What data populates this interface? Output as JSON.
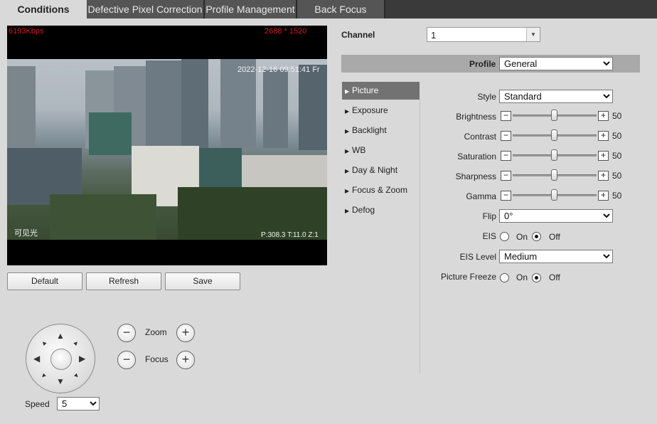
{
  "tabs": [
    {
      "label": "Conditions"
    },
    {
      "label": "Defective Pixel Correction"
    },
    {
      "label": "Profile Management"
    },
    {
      "label": "Back Focus"
    }
  ],
  "video": {
    "bitrate": "6193Kbps",
    "resolution": "2688 * 1520",
    "timestamp": "2022-12-16 09:51:41 Fr",
    "channel_name": "可见光",
    "ptz_position": "P:308.3 T:11.0 Z:1"
  },
  "video_buttons": {
    "default": "Default",
    "refresh": "Refresh",
    "save": "Save"
  },
  "ptz": {
    "zoom": "Zoom",
    "focus": "Focus",
    "speed_label": "Speed",
    "speed_value": "5",
    "minus": "−",
    "plus": "+"
  },
  "channel": {
    "label": "Channel",
    "value": "1"
  },
  "profile": {
    "label": "Profile",
    "value": "General"
  },
  "menu": [
    {
      "label": "Picture",
      "active": true
    },
    {
      "label": "Exposure"
    },
    {
      "label": "Backlight"
    },
    {
      "label": "WB"
    },
    {
      "label": "Day & Night"
    },
    {
      "label": "Focus & Zoom"
    },
    {
      "label": "Defog"
    }
  ],
  "picture": {
    "style_label": "Style",
    "style_value": "Standard",
    "sliders": [
      {
        "label": "Brightness",
        "value": 50
      },
      {
        "label": "Contrast",
        "value": 50
      },
      {
        "label": "Saturation",
        "value": 50
      },
      {
        "label": "Sharpness",
        "value": 50
      },
      {
        "label": "Gamma",
        "value": 50
      }
    ],
    "flip_label": "Flip",
    "flip_value": "0°",
    "eis_label": "EIS",
    "eis_on": "On",
    "eis_off": "Off",
    "eis_selected": "Off",
    "eis_level_label": "EIS Level",
    "eis_level_value": "Medium",
    "freeze_label": "Picture Freeze",
    "freeze_on": "On",
    "freeze_off": "Off",
    "freeze_selected": "Off"
  },
  "colors": {
    "active_tab_bg": "#d9d9d9",
    "tab_bar": "#3a3a3a",
    "menu_active": "#727272",
    "overlay_red": "#d21b1b"
  }
}
